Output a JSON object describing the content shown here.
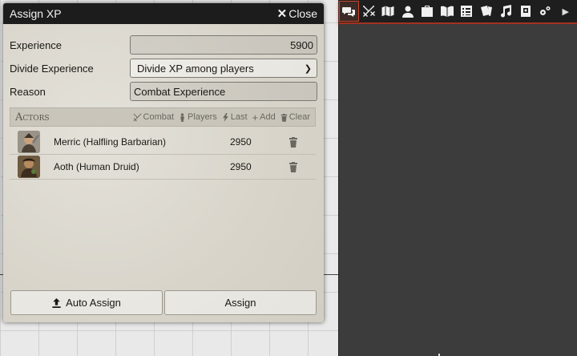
{
  "dialog": {
    "title": "Assign XP",
    "close_label": "Close",
    "experience_label": "Experience",
    "experience_value": "5900",
    "divide_label": "Divide Experience",
    "divide_selected": "Divide XP among players",
    "reason_label": "Reason",
    "reason_value": "Combat Experience",
    "actors_heading": "Actors",
    "header_buttons": {
      "combat": "Combat",
      "players": "Players",
      "last": "Last",
      "add": "Add",
      "clear": "Clear"
    },
    "actors": [
      {
        "name": "Merric (Halfling Barbarian)",
        "xp": "2950"
      },
      {
        "name": "Aoth (Human Druid)",
        "xp": "2950"
      }
    ],
    "auto_assign_label": "Auto Assign",
    "assign_label": "Assign"
  },
  "sidebar": {
    "tabs": [
      {
        "icon": "chat-bubbles-icon"
      },
      {
        "icon": "crossed-swords-icon"
      },
      {
        "icon": "map-icon"
      },
      {
        "icon": "user-icon"
      },
      {
        "icon": "suitcase-icon"
      },
      {
        "icon": "book-icon"
      },
      {
        "icon": "table-icon"
      },
      {
        "icon": "cards-icon"
      },
      {
        "icon": "music-icon"
      },
      {
        "icon": "compendium-icon"
      },
      {
        "icon": "gears-icon"
      },
      {
        "icon": "collapse-arrow-icon"
      }
    ],
    "accent_color": "#c8452a"
  }
}
